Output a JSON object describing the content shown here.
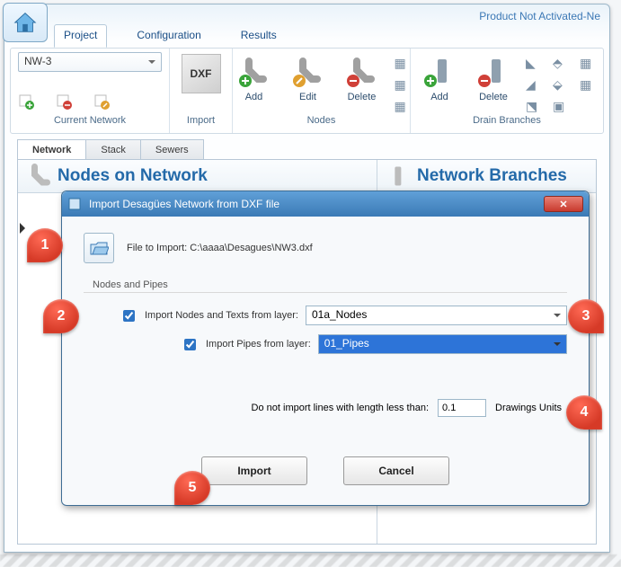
{
  "status": {
    "text": "Product Not Activated-Ne"
  },
  "menu": {
    "project": "Project",
    "configuration": "Configuration",
    "results": "Results",
    "active": "project"
  },
  "ribbon": {
    "current_network": {
      "title": "Current Network",
      "combo_value": "NW-3"
    },
    "import": {
      "title": "Import",
      "dxf_label": "DXF"
    },
    "nodes": {
      "title": "Nodes",
      "add": "Add",
      "edit": "Edit",
      "delete": "Delete"
    },
    "drain": {
      "title": "Drain Branches",
      "add": "Add",
      "delete": "Delete"
    }
  },
  "subtabs": {
    "network": "Network",
    "stack": "Stack",
    "sewers": "Sewers",
    "active": "network"
  },
  "pane_left": {
    "title": "Nodes on Network"
  },
  "pane_right": {
    "title": "Network Branches"
  },
  "dialog": {
    "title": "Import Desagües Network from DXF file",
    "file_label": "File to Import: C:\\aaaa\\Desagues\\NW3.dxf",
    "group": "Nodes and Pipes",
    "opt_nodes_label": "Import Nodes and Texts from layer:",
    "opt_pipes_label": "Import Pipes from layer:",
    "layer_nodes": "01a_Nodes",
    "layer_pipes": "01_Pipes",
    "opt_nodes_checked": true,
    "opt_pipes_checked": true,
    "len_label": "Do not import lines with length less than:",
    "len_value": "0.1",
    "len_units": "Drawings Units",
    "import_btn": "Import",
    "cancel_btn": "Cancel"
  },
  "callouts": {
    "1": "1",
    "2": "2",
    "3": "3",
    "4": "4",
    "5": "5"
  }
}
